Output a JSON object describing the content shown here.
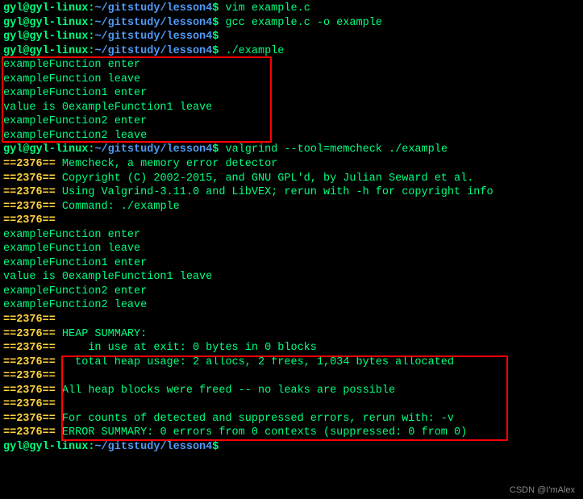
{
  "prompt": {
    "user": "gyl@gyl-linux",
    "colon": ":",
    "path": "~/gitstudy/lesson4",
    "dollar": "$"
  },
  "commands": {
    "c1": " vim example.c",
    "c2": " gcc example.c -o example",
    "c3": "",
    "c4": " ./example",
    "c5": " valgrind --tool=memcheck ./example",
    "c6": ""
  },
  "output1": {
    "l1": "exampleFunction enter",
    "l2": "exampleFunction leave",
    "l3": "exampleFunction1 enter",
    "l4": "value is 0exampleFunction1 leave",
    "l5": "exampleFunction2 enter",
    "l6": "exampleFunction2 leave"
  },
  "valgrind": {
    "pid_prefix": "==2376== ",
    "pid_only": "==2376==",
    "l1": "Memcheck, a memory error detector",
    "l2": "Copyright (C) 2002-2015, and GNU GPL'd, by Julian Seward et al.",
    "l3": "Using Valgrind-3.11.0 and LibVEX; rerun with -h for copyright info",
    "l4": "Command: ./example",
    "l5": "",
    "heap_summary": "HEAP SUMMARY:",
    "heap_inuse": "    in use at exit: 0 bytes in 0 blocks",
    "heap_total": "  total heap usage: 2 allocs, 2 frees, 1,034 bytes allocated",
    "freed": "All heap blocks were freed -- no leaks are possible",
    "counts": "For counts of detected and suppressed errors, rerun with: -v",
    "err_summary": "ERROR SUMMARY: 0 errors from 0 contexts (suppressed: 0 from 0)"
  },
  "watermark": "CSDN @I'mAlex"
}
